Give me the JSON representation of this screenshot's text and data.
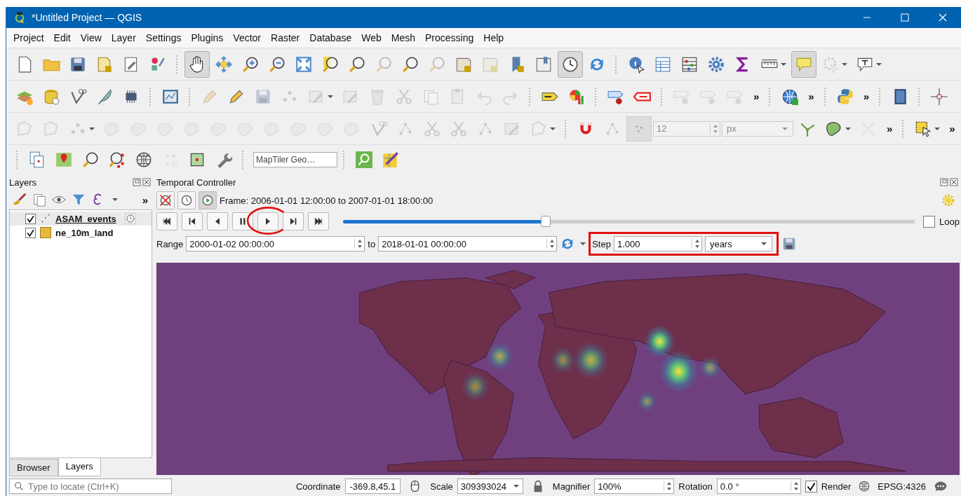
{
  "window": {
    "title": "*Untitled Project — QGIS"
  },
  "menu": [
    "Project",
    "Edit",
    "View",
    "Layer",
    "Settings",
    "Plugins",
    "Vector",
    "Raster",
    "Database",
    "Web",
    "Mesh",
    "Processing",
    "Help"
  ],
  "toolbars": [
    {
      "pan_button": {
        "selected": true
      },
      "temporal_button": {
        "selected": true
      },
      "map_tips_button": {
        "selected": true
      }
    },
    {
      "chevrons": [
        "»",
        "»",
        "»"
      ]
    },
    {
      "chevrons": [
        "»",
        "»"
      ],
      "snap_tolerance": "12",
      "snap_unit": "px"
    },
    {
      "search_placeholder": "MapTiler Geo…"
    }
  ],
  "layers_panel": {
    "title": "Layers",
    "overflow": "»",
    "layers": [
      {
        "name": "ASAM_events",
        "checked": true,
        "selected": true,
        "kind": "points",
        "temporal": true
      },
      {
        "name": "ne_10m_land",
        "checked": true,
        "selected": false,
        "kind": "polygon",
        "temporal": false
      }
    ],
    "tabs": [
      {
        "label": "Browser",
        "selected": false
      },
      {
        "label": "Layers",
        "selected": true
      }
    ]
  },
  "temporal_controller": {
    "title": "Temporal Controller",
    "mode_buttons": [
      {
        "kind": "off",
        "selected": false
      },
      {
        "kind": "fixed",
        "selected": false
      },
      {
        "kind": "animated",
        "selected": true
      }
    ],
    "frame": "Frame: 2006-01-01 12:00:00 to 2007-01-01 18:00:00",
    "playback_buttons": [
      {
        "kind": "first"
      },
      {
        "kind": "previous"
      },
      {
        "kind": "reverse"
      },
      {
        "kind": "pause"
      },
      {
        "kind": "play"
      },
      {
        "kind": "next"
      },
      {
        "kind": "last"
      }
    ],
    "level": 0.355,
    "loop": {
      "label": "Loop",
      "checked": false
    },
    "range_label": "Range",
    "range_start": "2000-01-02 00:00:00",
    "to_label": "to",
    "range_end": "2018-01-01 00:00:00",
    "step_label": "Step",
    "step_value": "1.000",
    "step_unit": "years"
  },
  "status_bar": {
    "locate_placeholder": "Type to locate (Ctrl+K)",
    "coordinate_label": "Coordinate",
    "coordinate": "-369.8,45.1",
    "scale_label": "Scale",
    "scale": "309393024",
    "magnifier_label": "Magnifier",
    "magnifier": "100%",
    "rotation_label": "Rotation",
    "rotation": "0.0 °",
    "render": {
      "label": "Render",
      "checked": true
    },
    "crs": "EPSG:4326"
  }
}
